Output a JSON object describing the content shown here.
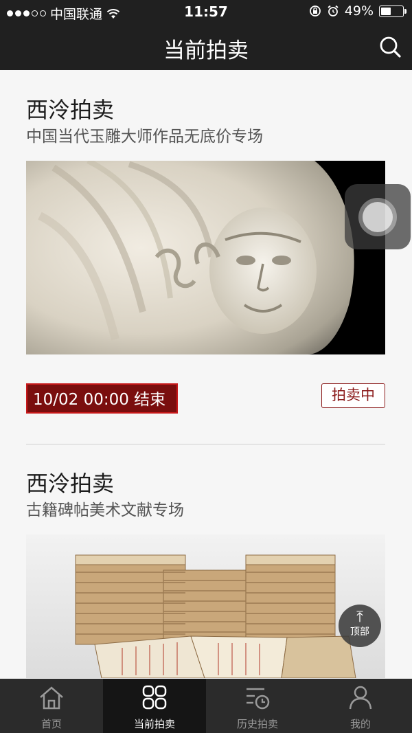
{
  "status_bar": {
    "carrier": "中国联通",
    "time": "11:57",
    "battery": "49%"
  },
  "header": {
    "title": "当前拍卖"
  },
  "auctions": [
    {
      "house": "西泠拍卖",
      "subtitle": "中国当代玉雕大师作品无底价专场",
      "end_time": "10/02 00:00  结束",
      "status": "拍卖中"
    },
    {
      "house": "西泠拍卖",
      "subtitle": "古籍碑帖美术文献专场"
    }
  ],
  "back_to_top": {
    "label": "顶部"
  },
  "tab_bar": {
    "tabs": [
      {
        "label": "首页"
      },
      {
        "label": "当前拍卖"
      },
      {
        "label": "历史拍卖"
      },
      {
        "label": "我的"
      }
    ]
  },
  "colors": {
    "header_bg": "#202020",
    "accent_red": "#7a0e0e",
    "tab_active_bg": "#151515"
  }
}
